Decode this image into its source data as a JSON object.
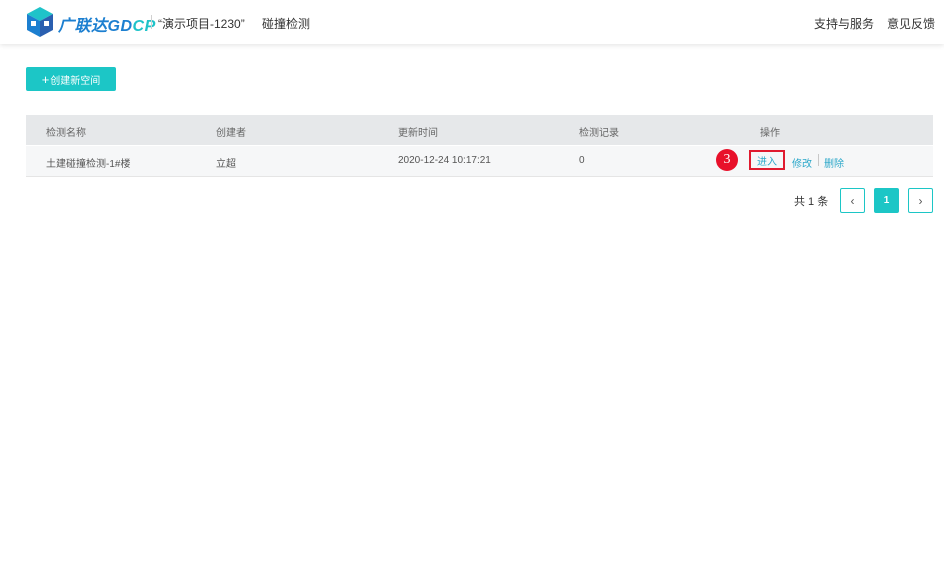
{
  "header": {
    "brand_prefix": "广联达",
    "brand_gd": "GD",
    "brand_cp": "CP",
    "project": "“演示项目-1230”",
    "module": "碰撞检测",
    "nav": {
      "support": "支持与服务",
      "feedback": "意见反馈"
    }
  },
  "toolbar": {
    "create_label": "创建新空间",
    "create_icon": "plus-icon"
  },
  "table": {
    "columns": [
      "检测名称",
      "创建者",
      "更新时间",
      "检测记录",
      "操作"
    ],
    "rows": [
      {
        "name": "土建碰撞检测-1#楼",
        "creator": "立超",
        "updated": "2020-12-24 10:17:21",
        "records": "0"
      }
    ],
    "actions": {
      "enter": "进入",
      "edit": "修改",
      "delete": "删除"
    }
  },
  "annotation": {
    "step": "3"
  },
  "pagination": {
    "total": "共 1 条",
    "current": "1"
  },
  "colors": {
    "accent": "#1cc6c6",
    "brand_blue": "#1c7fd0",
    "highlight": "#e01b2f",
    "link": "#2aa7c9"
  }
}
